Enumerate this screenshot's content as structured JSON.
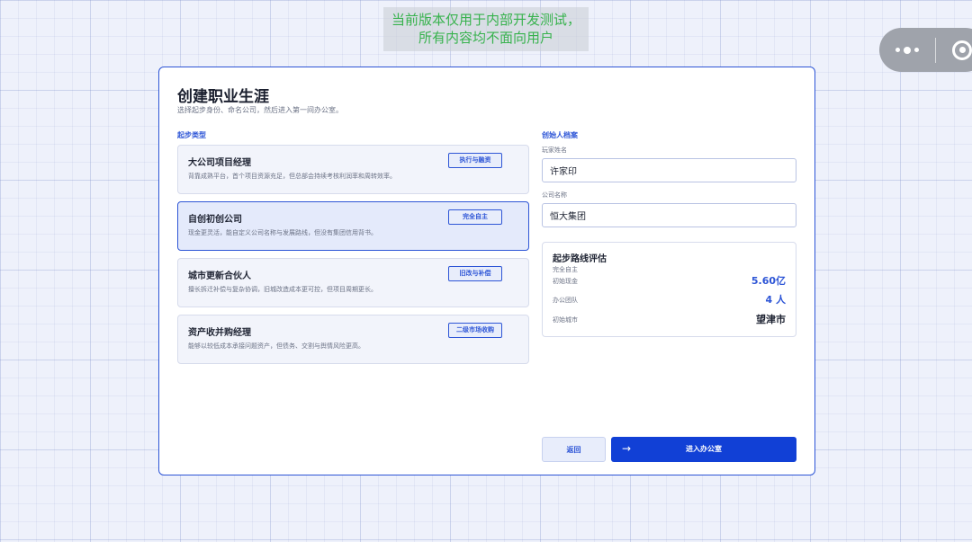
{
  "banner": {
    "line1": "当前版本仅用于内部开发测试，",
    "line2": "所有内容均不面向用户"
  },
  "page": {
    "title": "创建职业生涯",
    "subtitle": "选择起步身份、命名公司，然后进入第一间办公室。"
  },
  "start_types": {
    "label": "起步类型",
    "items": [
      {
        "name": "大公司项目经理",
        "desc": "背靠成熟平台，首个项目资源充足，但总部会持续考核利润率和周转效率。",
        "tag": "执行与融资",
        "selected": false
      },
      {
        "name": "自创初创公司",
        "desc": "现金更灵活，能自定义公司名称与发展路线，但没有集团信用背书。",
        "tag": "完全自主",
        "selected": true
      },
      {
        "name": "城市更新合伙人",
        "desc": "擅长拆迁补偿与复杂协调，旧城改造成本更可控，但项目周期更长。",
        "tag": "旧改与补偿",
        "selected": false
      },
      {
        "name": "资产收并购经理",
        "desc": "能够以较低成本承接问题资产，但债务、交割与舆情风险更高。",
        "tag": "二级市场收购",
        "selected": false
      }
    ]
  },
  "founder": {
    "label": "创始人档案",
    "player_name_label": "玩家姓名",
    "player_name_value": "许家印",
    "company_name_label": "公司名称",
    "company_name_value": "恒大集团"
  },
  "evaluation": {
    "title": "起步路线评估",
    "route": "完全自主",
    "rows": [
      {
        "key": "初始现金",
        "value": "5.60亿"
      },
      {
        "key": "办公团队",
        "value": "4 人"
      },
      {
        "key": "初始城市",
        "value": "望津市"
      }
    ]
  },
  "actions": {
    "back": "返回",
    "enter": "进入办公室",
    "enter_icon": "→"
  },
  "colors": {
    "accent": "#2d55d6",
    "primary_button": "#1140d6",
    "banner_text": "#37b24d",
    "value_blue": "#2d55d6",
    "value_dark": "#1f2433"
  }
}
